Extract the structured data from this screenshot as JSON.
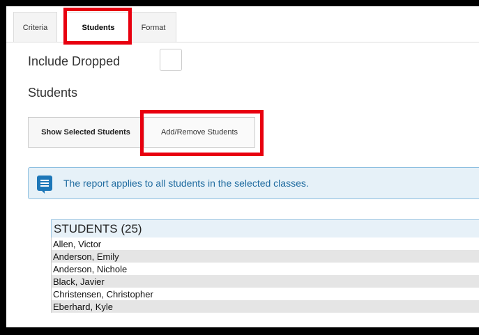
{
  "tabs": [
    {
      "label": "Criteria"
    },
    {
      "label": "Students"
    },
    {
      "label": "Format"
    }
  ],
  "include_dropped": {
    "label": "Include Dropped",
    "checked": false
  },
  "students_section": {
    "heading": "Students"
  },
  "buttons": {
    "show_selected": "Show Selected Students",
    "add_remove": "Add/Remove Students"
  },
  "alert": {
    "icon": "message-icon",
    "text": "The report applies to all students in the selected classes."
  },
  "students_table": {
    "header": "STUDENTS (25)",
    "rows": [
      "Allen, Victor",
      "Anderson, Emily",
      "Anderson, Nichole",
      "Black, Javier",
      "Christensen, Christopher",
      "Eberhard, Kyle"
    ]
  },
  "colors": {
    "highlight": "#e8000f",
    "alert_icon": "#1d77b8",
    "alert_bg": "#e6f1f8"
  }
}
